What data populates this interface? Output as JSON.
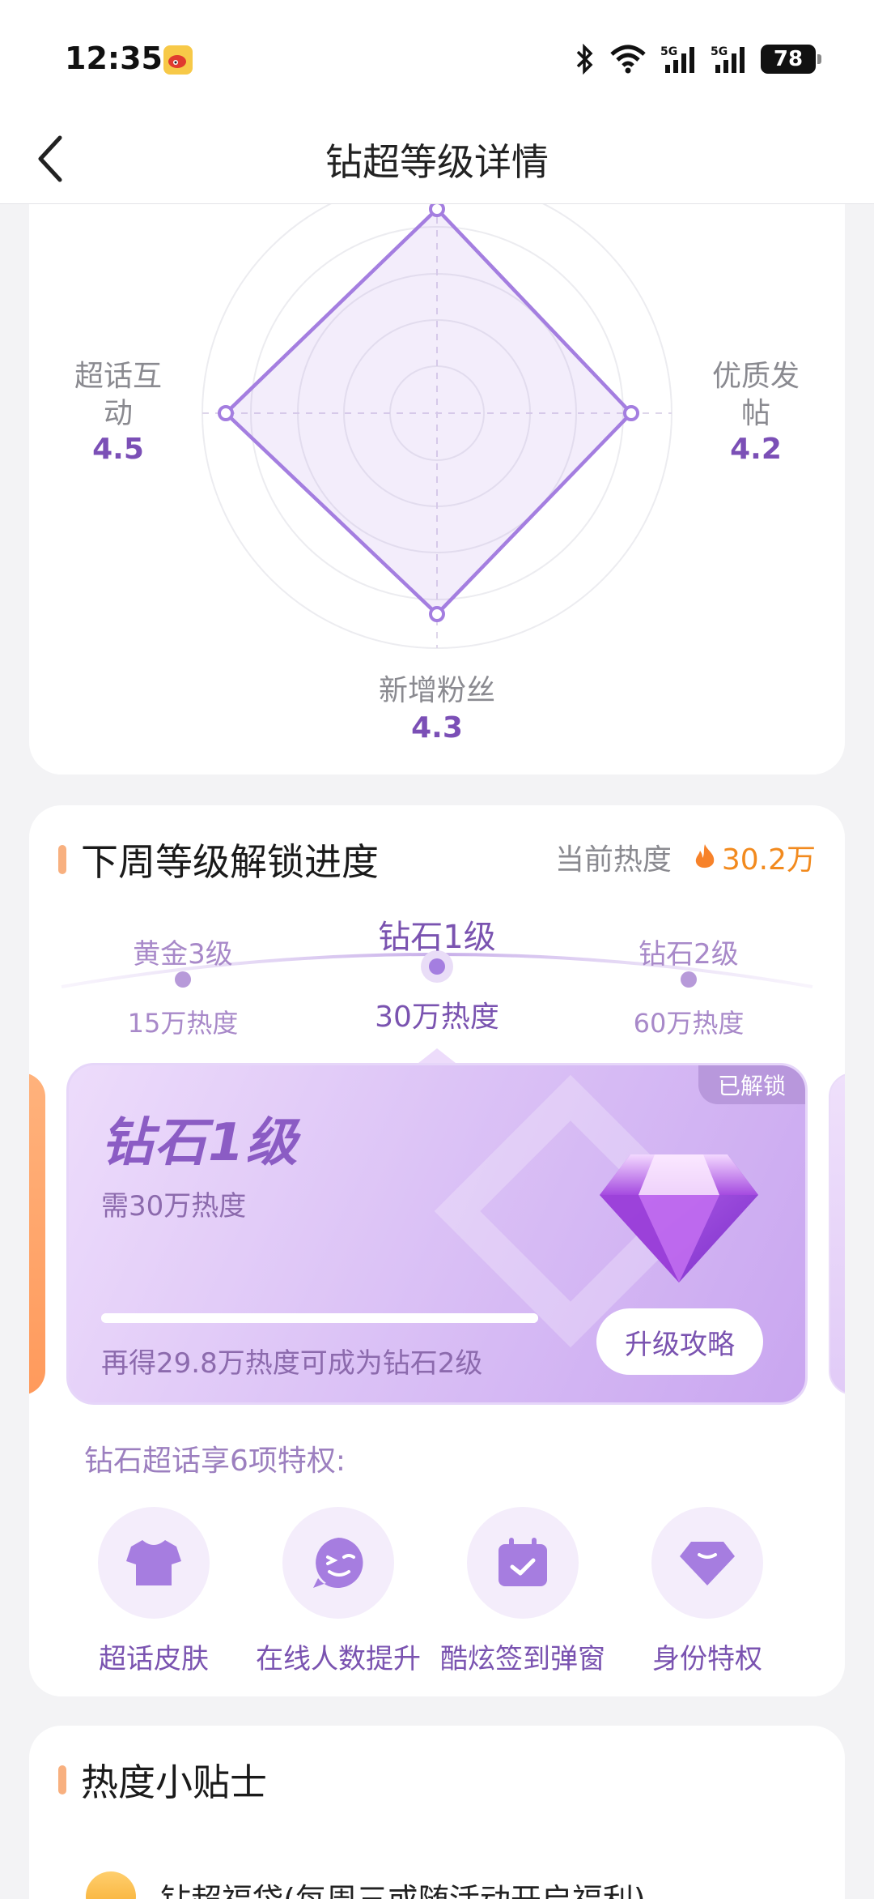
{
  "status_bar": {
    "time": "12:35",
    "battery": "78",
    "icons": [
      "weibo-icon",
      "bluetooth-icon",
      "wifi-icon",
      "signal-5g-icon",
      "signal-5g-icon"
    ]
  },
  "nav": {
    "title": "钻超等级详情",
    "back_icon": "chevron-left-icon"
  },
  "radar": {
    "axes": [
      {
        "label": "超话互\n动",
        "value": "4.5"
      },
      {
        "label": "优质发\n帖",
        "value": "4.2"
      },
      {
        "label": "新增粉丝",
        "value": "4.3"
      }
    ],
    "accent": "#9b6fd6"
  },
  "unlock": {
    "title": "下周等级解锁进度",
    "current_heat_label": "当前热度",
    "current_heat_value": "30.2万",
    "levels": [
      {
        "name": "黄金3级",
        "heat": "15万热度"
      },
      {
        "name": "钻石1级",
        "heat": "30万热度"
      },
      {
        "name": "钻石2级",
        "heat": "60万热度"
      }
    ],
    "card": {
      "tag": "已解锁",
      "title": "钻石1级",
      "subtitle": "需30万热度",
      "progress": 1.0,
      "hint": "再得29.8万热度可成为钻石2级",
      "button": "升级攻略"
    },
    "privilege_title": "钻石超话享6项特权:",
    "privileges": [
      {
        "label": "超话皮肤",
        "icon": "tshirt-icon"
      },
      {
        "label": "在线人数提升",
        "icon": "wink-face-icon"
      },
      {
        "label": "酷炫签到弹窗",
        "icon": "calendar-check-icon"
      },
      {
        "label": "身份特权",
        "icon": "diamond-badge-icon"
      }
    ]
  },
  "tips": {
    "title": "热度小贴士",
    "items": [
      {
        "text": "钻超福袋(每周三或随活动开启福利)",
        "icon": "money-bag-icon"
      }
    ]
  }
}
